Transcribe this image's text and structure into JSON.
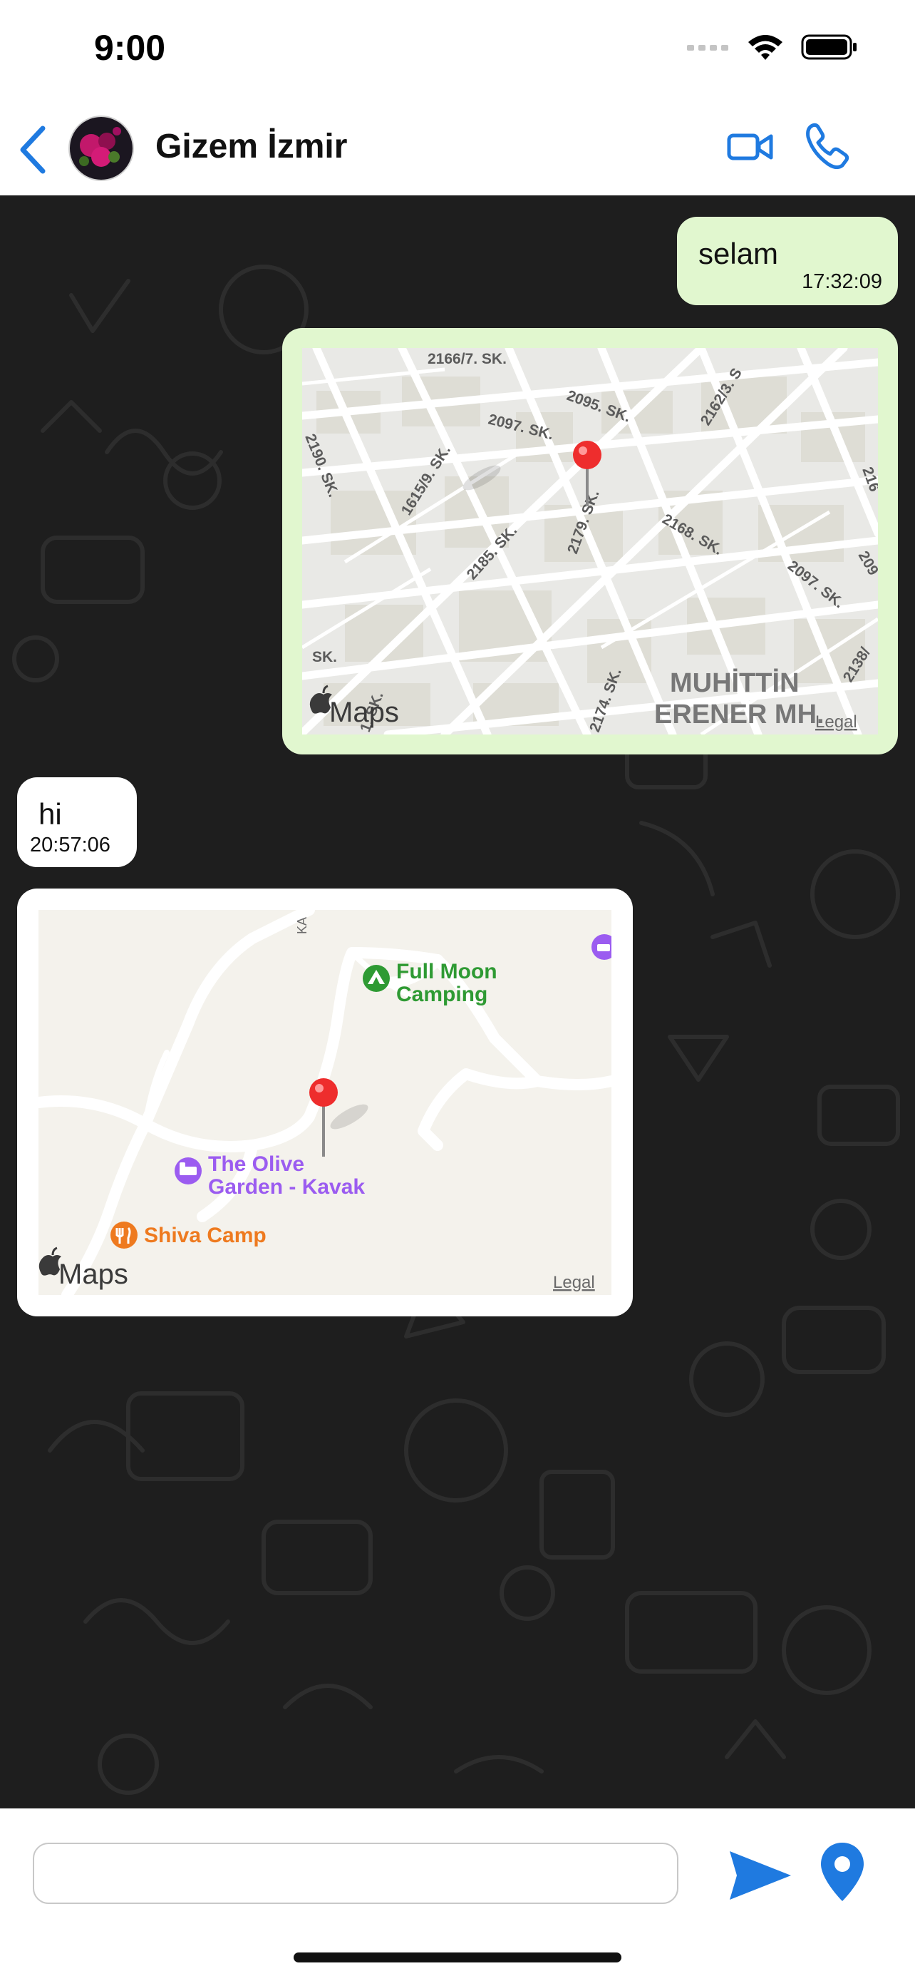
{
  "status_bar": {
    "time": "9:00"
  },
  "header": {
    "contact_name": "Gizem İzmir"
  },
  "messages": [
    {
      "direction": "outgoing",
      "text": "selam",
      "time": "17:32:09"
    },
    {
      "direction": "outgoing",
      "type": "map",
      "streets": [
        "2166/7. SK.",
        "2095. SK.",
        "2097. SK.",
        "2162/3. S",
        "2190. SK.",
        "1615/9. SK.",
        "2179. SK.",
        "2185. SK.",
        "2168. SK.",
        "2097. SK.",
        "2138/",
        "209",
        "216",
        "SK.",
        "1. SK.",
        "2174. SK."
      ],
      "district": [
        "MUHİTTİN",
        "ERENER MH."
      ],
      "attribution": "Maps",
      "legal": "Legal"
    },
    {
      "direction": "incoming",
      "text": "hi",
      "time": "20:57:06"
    },
    {
      "direction": "incoming",
      "type": "map",
      "road_label": "KA",
      "places": [
        {
          "name_lines": [
            "Full Moon",
            "Camping"
          ],
          "icon": "campsite-icon",
          "color": "#2e9a33"
        },
        {
          "name_lines": [
            "The Olive",
            "Garden - Kavak"
          ],
          "icon": "hotel-icon",
          "color": "#9b5cf0"
        },
        {
          "name_lines": [
            "Shiva Camp"
          ],
          "icon": "restaurant-icon",
          "color": "#ee7a1f"
        }
      ],
      "attribution": "Maps",
      "legal": "Legal"
    }
  ],
  "composer": {
    "value": "",
    "placeholder": ""
  },
  "colors": {
    "accent": "#1f7ae0",
    "outgoing_bubble": "#e1f7cf",
    "incoming_bubble": "#ffffff",
    "chat_background": "#1e1e1e",
    "pin": "#ee2d2d"
  }
}
